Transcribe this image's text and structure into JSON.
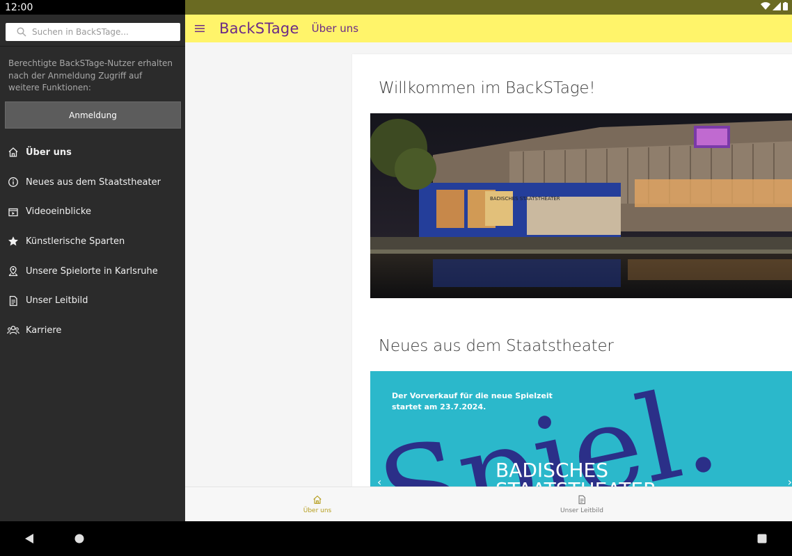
{
  "status": {
    "time": "12:00"
  },
  "drawer": {
    "search_placeholder": "Suchen in BackSTage...",
    "hint": "Berechtigte BackSTage-Nutzer erhalten nach der Anmeldung Zugriff auf weitere Funktionen:",
    "login_label": "Anmeldung",
    "items": [
      {
        "label": "Über uns",
        "icon": "home-icon",
        "active": true
      },
      {
        "label": "Neues aus dem Staatstheater",
        "icon": "info-icon",
        "active": false
      },
      {
        "label": "Videoeinblicke",
        "icon": "video-icon",
        "active": false
      },
      {
        "label": "Künstlerische Sparten",
        "icon": "star-icon",
        "active": false
      },
      {
        "label": "Unsere Spielorte in Karlsruhe",
        "icon": "map-pin-icon",
        "active": false
      },
      {
        "label": "Unser Leitbild",
        "icon": "document-icon",
        "active": false
      },
      {
        "label": "Karriere",
        "icon": "people-icon",
        "active": false
      }
    ]
  },
  "appbar": {
    "brand": "BackSTage",
    "title": "Über uns"
  },
  "main": {
    "welcome_heading": "Willkommen im BackSTage!",
    "news_heading": "Neues aus dem Staatstheater",
    "banner": {
      "line1": "Der Vorverkauf für die neue Spielzeit",
      "line2": "startet am 23.7.2024.",
      "big_word": "Spiel.",
      "org_line1": "BADISCHES",
      "org_line2": "STAATSTHEATER"
    },
    "photo_sign": "BADISCHES STAATSTHEATER"
  },
  "bottom_nav": [
    {
      "label": "Über uns",
      "icon": "home-icon",
      "active": true
    },
    {
      "label": "Unser Leitbild",
      "icon": "document-icon",
      "active": false
    }
  ],
  "colors": {
    "appbar": "#fff46a",
    "brand": "#6b2a87",
    "drawer": "#2b2b2b",
    "active_nav": "#b59d1c",
    "banner": "#2bb8cb"
  }
}
